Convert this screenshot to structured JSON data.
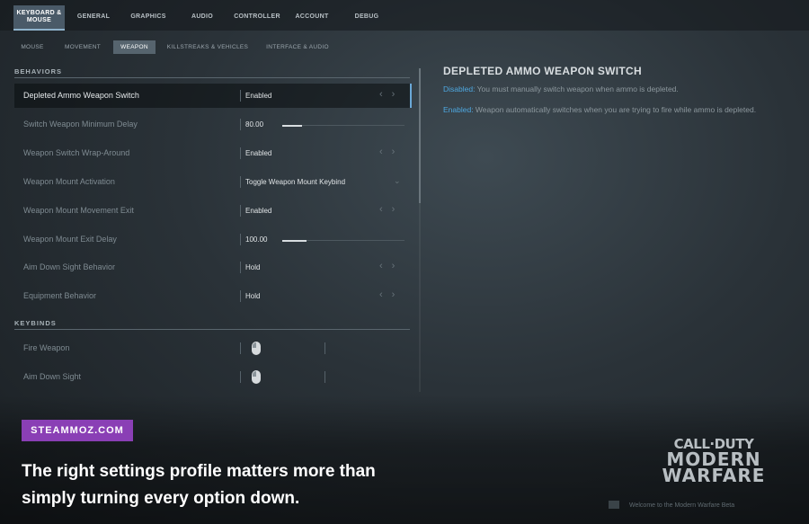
{
  "top_tabs": [
    "KEYBOARD &\nMOUSE",
    "GENERAL",
    "GRAPHICS",
    "AUDIO",
    "CONTROLLER",
    "ACCOUNT",
    "DEBUG"
  ],
  "sub_tabs": [
    "MOUSE",
    "MOVEMENT",
    "WEAPON",
    "KILLSTREAKS & VEHICLES",
    "INTERFACE & AUDIO"
  ],
  "sections": {
    "behaviors": "BEHAVIORS",
    "keybinds": "KEYBINDS"
  },
  "behaviors": [
    {
      "label": "Depleted Ammo Weapon Switch",
      "value": "Enabled"
    },
    {
      "label": "Switch Weapon Minimum Delay",
      "value": "80.00",
      "slider": 0.16
    },
    {
      "label": "Weapon Switch Wrap-Around",
      "value": "Enabled"
    },
    {
      "label": "Weapon Mount Activation",
      "value": "Toggle Weapon Mount Keybind"
    },
    {
      "label": "Weapon Mount Movement Exit",
      "value": "Enabled"
    },
    {
      "label": "Weapon Mount Exit Delay",
      "value": "100.00",
      "slider": 0.2
    },
    {
      "label": "Aim Down Sight Behavior",
      "value": "Hold"
    },
    {
      "label": "Equipment Behavior",
      "value": "Hold"
    }
  ],
  "keybinds": [
    {
      "label": "Fire Weapon"
    },
    {
      "label": "Aim Down Sight"
    }
  ],
  "detail": {
    "title": "DEPLETED AMMO WEAPON SWITCH",
    "disabled_key": "Disabled:",
    "disabled_text": " You must manually switch weapon when ammo is depleted.",
    "enabled_key": "Enabled:",
    "enabled_text": " Weapon automatically switches when you are trying to fire while ammo is depleted."
  },
  "badge": "STEAMMOZ.COM",
  "caption": "The right settings profile matters more than simply turning every option down.",
  "logo": {
    "line1": "CALL·DUTY",
    "line2": "MODERN",
    "line3": "WARFARE"
  },
  "welcome": "Welcome to the Modern Warfare Beta",
  "colors": {
    "accent": "#4ea8e0",
    "badge": "#8a3fb5",
    "active_tab": "#4a5a68"
  }
}
